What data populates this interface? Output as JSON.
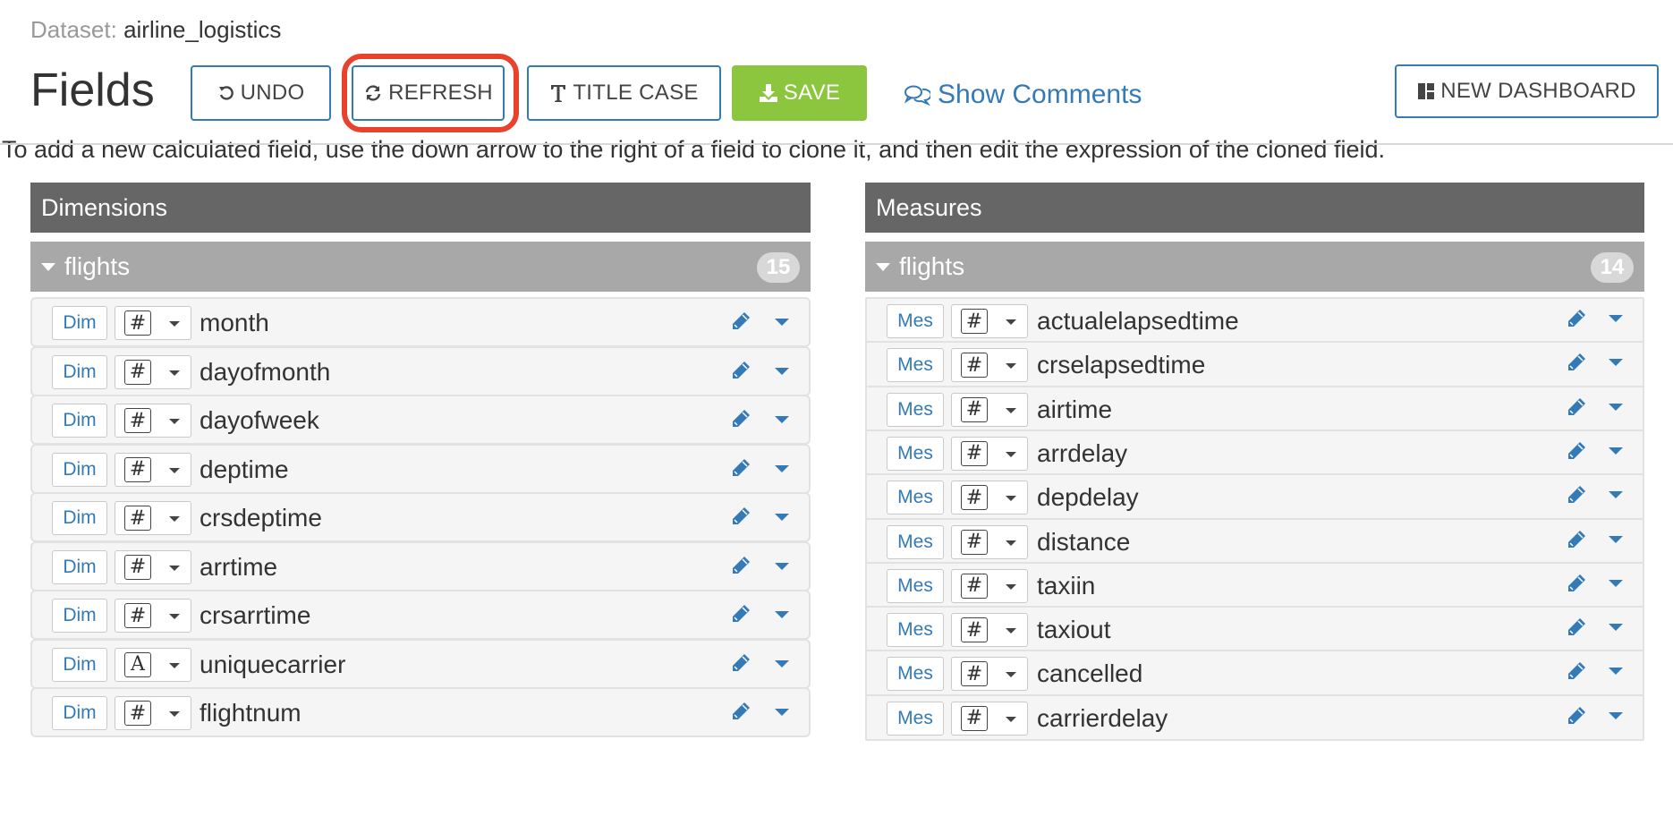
{
  "header": {
    "dataset_label": "Dataset:",
    "dataset_name": "airline_logistics",
    "page_title": "Fields"
  },
  "toolbar": {
    "undo_label": "UNDO",
    "refresh_label": "REFRESH",
    "title_case_label": "TITLE CASE",
    "save_label": "SAVE",
    "show_comments_label": "Show Comments",
    "new_dashboard_label": "NEW DASHBOARD"
  },
  "help_text": "To add a new calculated field, use the down arrow to the right of a field to clone it, and then edit the expression of the cloned field.",
  "colors": {
    "accent": "#337ab7",
    "save_green": "#8cc63f",
    "highlight_red": "#e8412c",
    "panel_header": "#666666",
    "group_header": "#a8a8a8"
  },
  "dimensions": {
    "title": "Dimensions",
    "group_name": "flights",
    "count": "15",
    "fields": [
      {
        "role": "Dim",
        "type_glyph": "#",
        "name": "month"
      },
      {
        "role": "Dim",
        "type_glyph": "#",
        "name": "dayofmonth"
      },
      {
        "role": "Dim",
        "type_glyph": "#",
        "name": "dayofweek"
      },
      {
        "role": "Dim",
        "type_glyph": "#",
        "name": "deptime"
      },
      {
        "role": "Dim",
        "type_glyph": "#",
        "name": "crsdeptime"
      },
      {
        "role": "Dim",
        "type_glyph": "#",
        "name": "arrtime"
      },
      {
        "role": "Dim",
        "type_glyph": "#",
        "name": "crsarrtime"
      },
      {
        "role": "Dim",
        "type_glyph": "A",
        "name": "uniquecarrier"
      },
      {
        "role": "Dim",
        "type_glyph": "#",
        "name": "flightnum"
      }
    ]
  },
  "measures": {
    "title": "Measures",
    "group_name": "flights",
    "count": "14",
    "fields": [
      {
        "role": "Mes",
        "type_glyph": "#",
        "name": "actualelapsedtime"
      },
      {
        "role": "Mes",
        "type_glyph": "#",
        "name": "crselapsedtime"
      },
      {
        "role": "Mes",
        "type_glyph": "#",
        "name": "airtime"
      },
      {
        "role": "Mes",
        "type_glyph": "#",
        "name": "arrdelay"
      },
      {
        "role": "Mes",
        "type_glyph": "#",
        "name": "depdelay"
      },
      {
        "role": "Mes",
        "type_glyph": "#",
        "name": "distance"
      },
      {
        "role": "Mes",
        "type_glyph": "#",
        "name": "taxiin"
      },
      {
        "role": "Mes",
        "type_glyph": "#",
        "name": "taxiout"
      },
      {
        "role": "Mes",
        "type_glyph": "#",
        "name": "cancelled"
      },
      {
        "role": "Mes",
        "type_glyph": "#",
        "name": "carrierdelay"
      }
    ]
  }
}
